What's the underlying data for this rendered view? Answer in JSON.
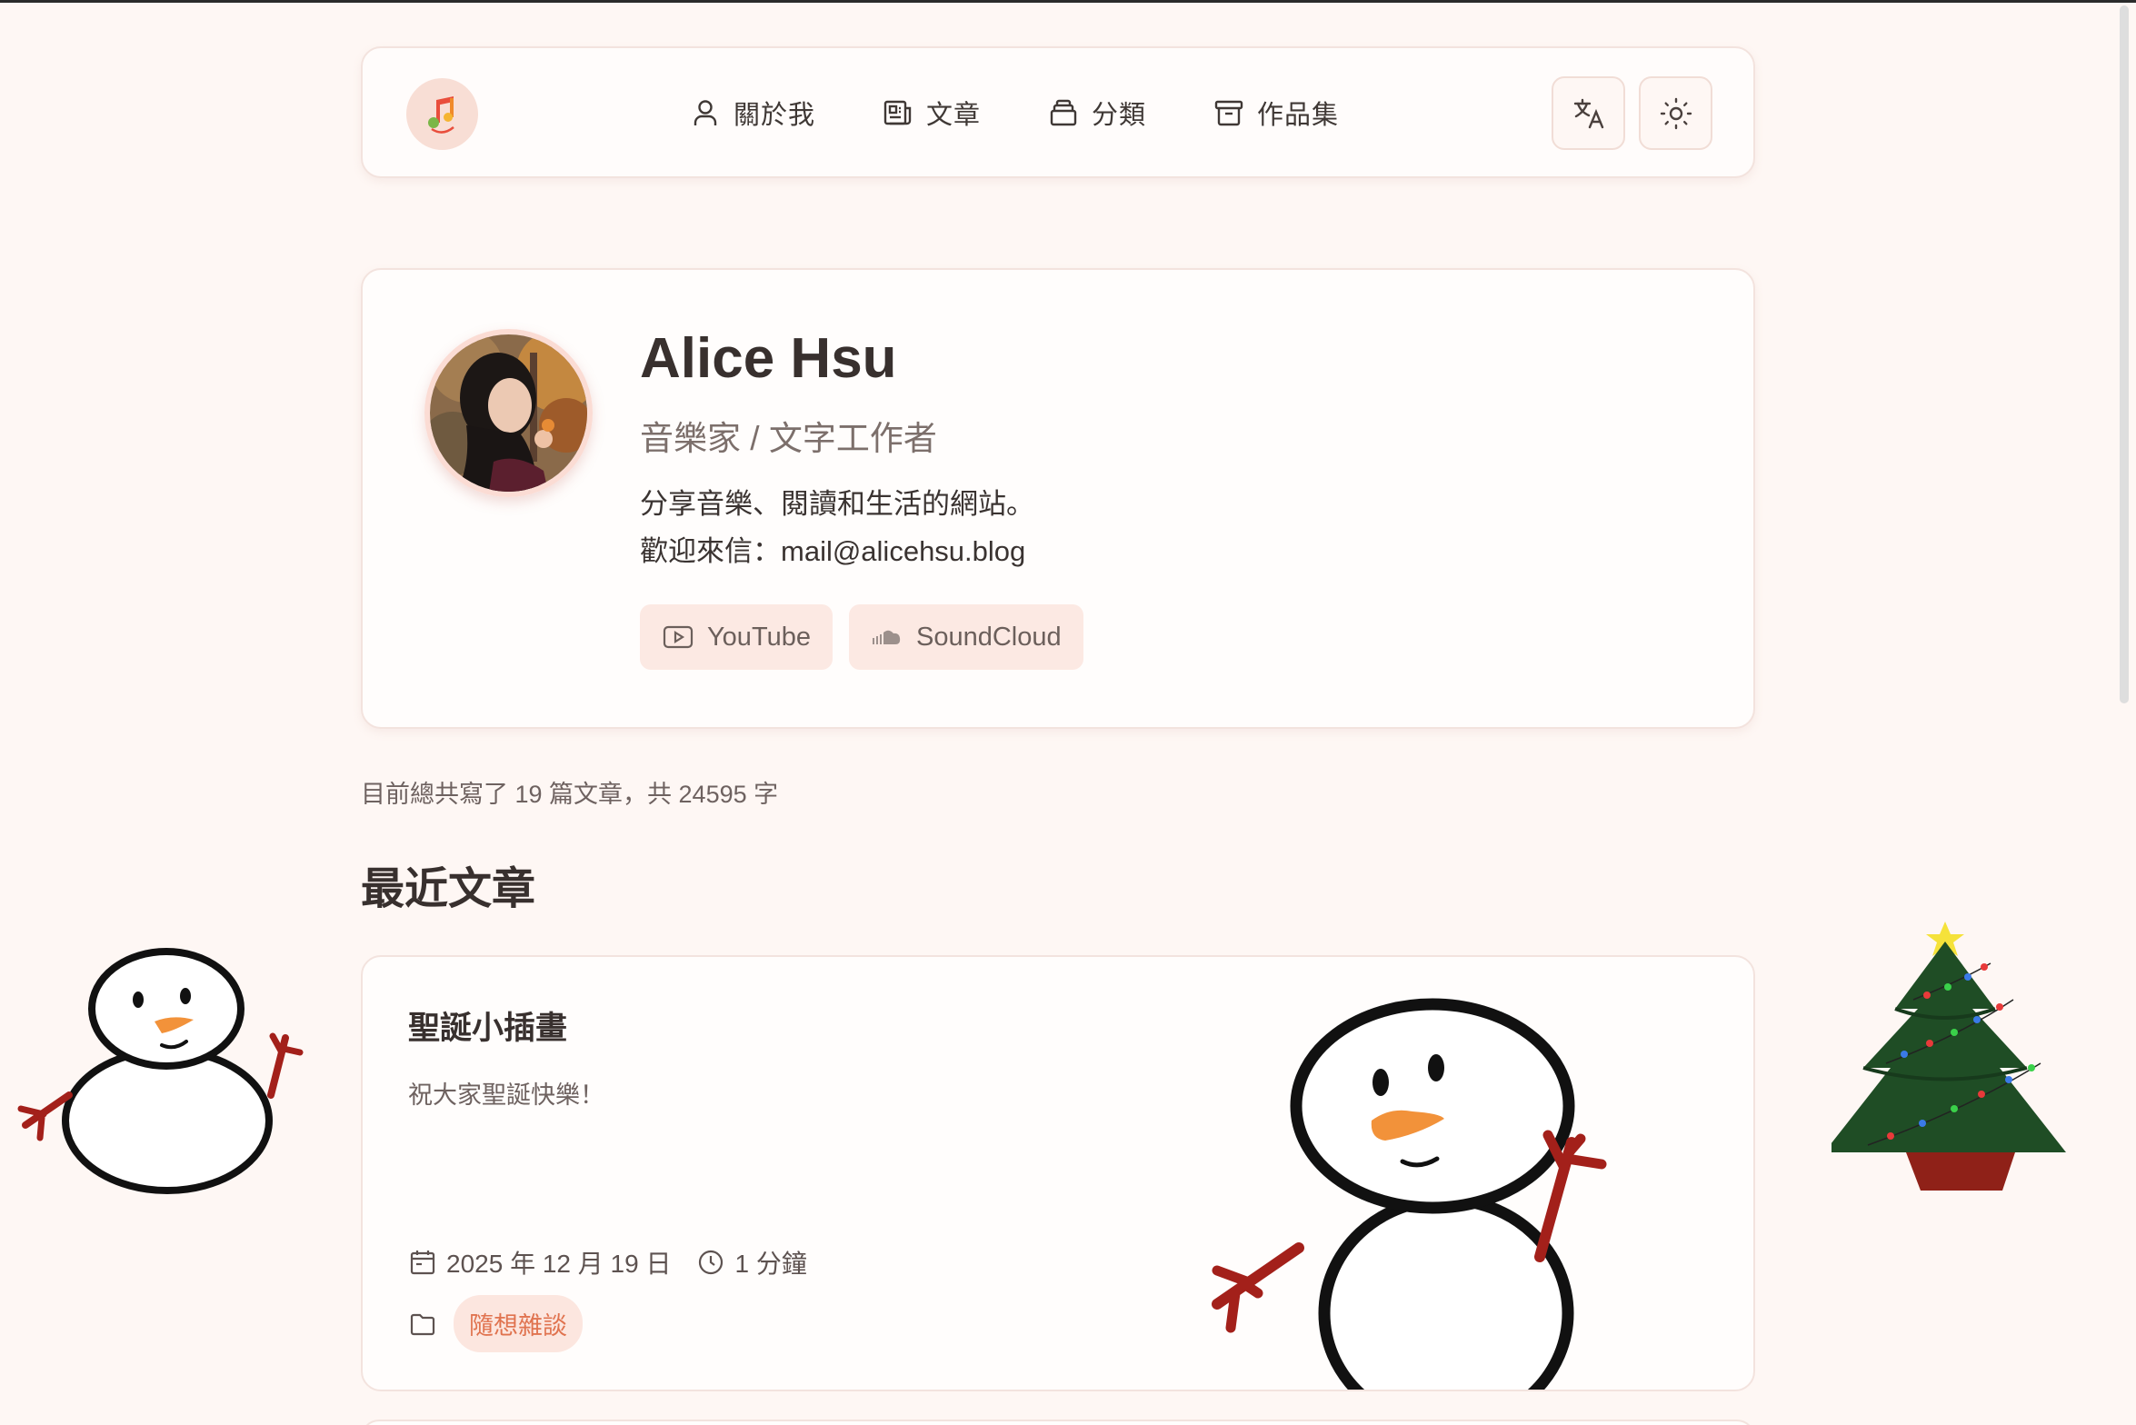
{
  "nav": {
    "logo_icon": "music-note-icon",
    "items": [
      {
        "label": "關於我",
        "icon": "person-icon"
      },
      {
        "label": "文章",
        "icon": "newspaper-icon"
      },
      {
        "label": "分類",
        "icon": "stack-icon"
      },
      {
        "label": "作品集",
        "icon": "archive-icon"
      }
    ],
    "translate_icon": "translate-icon",
    "theme_icon": "sun-icon"
  },
  "profile": {
    "name": "Alice Hsu",
    "role": "音樂家 / 文字工作者",
    "desc_line1": "分享音樂、閱讀和生活的網站。",
    "desc_line2": "歡迎來信：mail@alicehsu.blog",
    "links": [
      {
        "label": "YouTube",
        "icon": "youtube-icon"
      },
      {
        "label": "SoundCloud",
        "icon": "soundcloud-icon"
      }
    ]
  },
  "stats": "目前總共寫了 19 篇文章，共 24595 字",
  "section_title": "最近文章",
  "posts": [
    {
      "title": "聖誕小插畫",
      "excerpt": "祝大家聖誕快樂！",
      "date": "2025 年 12 月 19 日",
      "read_time": "1 分鐘",
      "category": "隨想雜談"
    }
  ],
  "colors": {
    "background": "#fef7f4",
    "accent": "#e0734f",
    "tag_bg": "#fce6df",
    "card_border": "#f3e3de"
  }
}
